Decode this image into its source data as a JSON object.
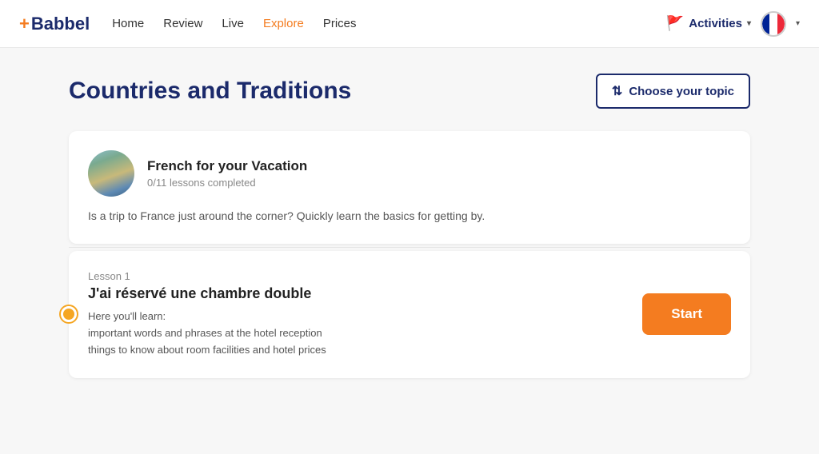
{
  "navbar": {
    "logo_plus": "+",
    "logo_text": "Babbel",
    "links": [
      {
        "label": "Home",
        "active": false
      },
      {
        "label": "Review",
        "active": false
      },
      {
        "label": "Live",
        "active": false
      },
      {
        "label": "Explore",
        "active": true
      },
      {
        "label": "Prices",
        "active": false
      }
    ],
    "activities_label": "Activities",
    "chevron": "▾"
  },
  "page": {
    "title": "Countries and Traditions",
    "topic_btn_label": "Choose your topic"
  },
  "course": {
    "title": "French for your Vacation",
    "progress": "0/11 lessons completed",
    "description": "Is a trip to France just around the corner? Quickly learn the basics for getting by."
  },
  "lesson": {
    "label": "Lesson 1",
    "title": "J'ai réservé une chambre double",
    "learn_label": "Here you'll learn:",
    "points": [
      "important words and phrases at the hotel reception",
      "things to know about room facilities and hotel prices"
    ],
    "start_btn": "Start"
  }
}
